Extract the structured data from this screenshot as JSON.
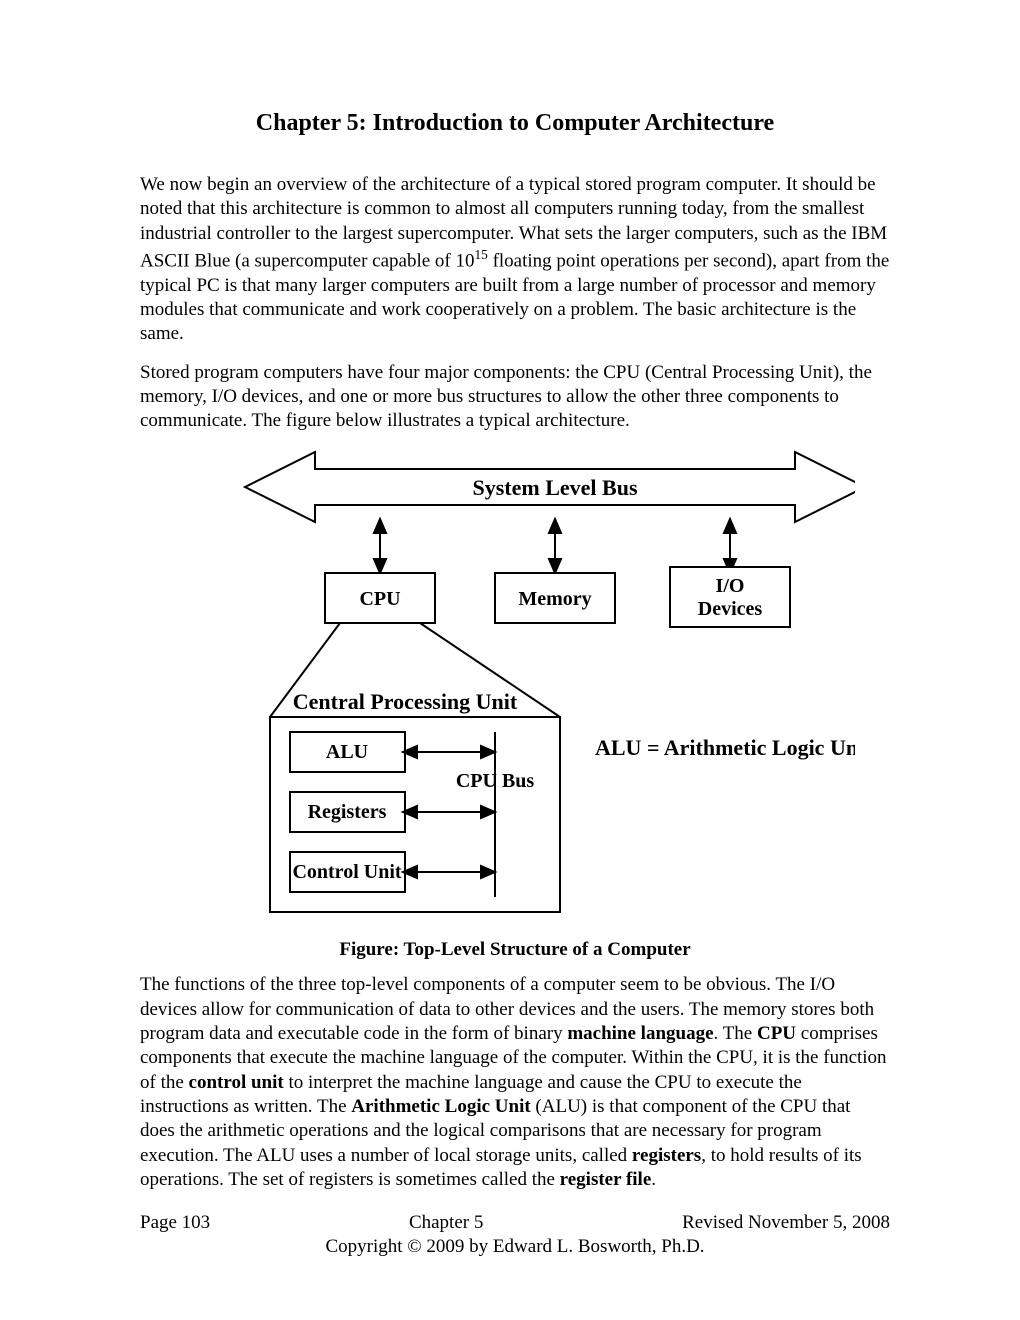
{
  "title": "Chapter 5: Introduction to Computer Architecture",
  "para1_a": "We now begin an overview of the architecture of a typical stored program computer.  It should be noted that this architecture is common to almost all computers running today, from the smallest industrial controller to the largest supercomputer.  What sets the larger computers, such as the IBM ASCII Blue (a supercomputer capable of 10",
  "para1_sup": "15",
  "para1_b": " floating point operations per second), apart from the typical PC is that many larger computers are built from a large number of processor and memory modules that communicate and work cooperatively on a problem.  The basic architecture is the same.",
  "para2": "Stored program computers have four major components: the CPU (Central Processing Unit), the memory, I/O devices, and one or more bus structures to allow the other three components to communicate.  The figure below illustrates a typical architecture.",
  "diagram": {
    "bus_label": "System Level Bus",
    "cpu": "CPU",
    "memory": "Memory",
    "io_l1": "I/O",
    "io_l2": "Devices",
    "cpu_heading": "Central Processing Unit",
    "alu": "ALU",
    "registers": "Registers",
    "control_unit": "Control Unit",
    "cpu_bus": "CPU Bus",
    "alu_note": "ALU = Arithmetic Logic Unit"
  },
  "figcaption": "Figure: Top-Level Structure of a Computer",
  "para3_segments": {
    "a": "The functions of the three top-level components of a computer seem to be obvious.  The I/O devices allow for communication of data to other devices and the users.  The memory stores both program data and executable code in the form of binary ",
    "b_bold": "machine language",
    "c": ".  The ",
    "d_bold": "CPU",
    "e": " comprises components that execute the machine language of the computer.  Within the CPU, it is the function of the ",
    "f_bold": "control unit",
    "g": " to interpret the machine language and cause the CPU to execute the instructions as written.  The ",
    "h_bold": "Arithmetic Logic Unit",
    "i": " (ALU) is that component of the CPU that does the arithmetic operations and the logical comparisons that are necessary for program execution.  The ALU uses a number of local storage units, called ",
    "j_bold": "registers",
    "k": ", to hold results of its operations.  The set of registers is sometimes called the ",
    "l_bold": "register file",
    "m": "."
  },
  "footer": {
    "page": "Page 103",
    "chapter": "Chapter 5",
    "revised": "Revised November 5, 2008",
    "copyright": "Copyright © 2009 by Edward L. Bosworth, Ph.D."
  }
}
